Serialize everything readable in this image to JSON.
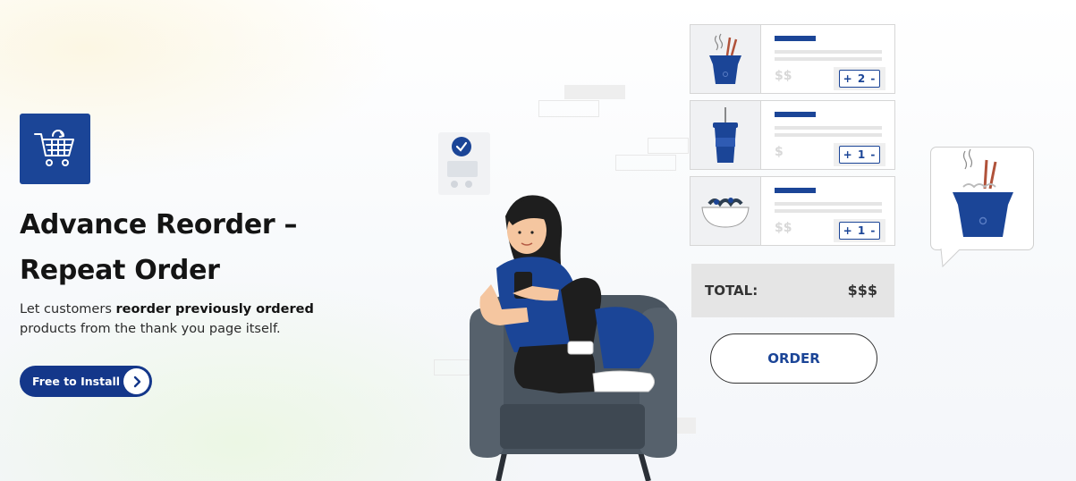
{
  "hero": {
    "title_line1": "Advance Reorder –",
    "title_line2": "Repeat Order",
    "subtitle_pre": "Let customers ",
    "subtitle_bold": "reorder previously ordered",
    "subtitle_post": " products from the thank you page itself.",
    "cta_label": "Free to Install"
  },
  "illustration": {
    "order_items": [
      {
        "icon": "noodle-box-icon",
        "price": "$$",
        "qty": "+ 2 -"
      },
      {
        "icon": "drink-cup-icon",
        "price": "$",
        "qty": "+ 1 -"
      },
      {
        "icon": "salad-bowl-icon",
        "price": "$$",
        "qty": "+ 1 -"
      }
    ],
    "total_label": "TOTAL:",
    "total_value": "$$$",
    "order_button": "ORDER"
  },
  "colors": {
    "brand_blue": "#1b4597",
    "cta_blue": "#14378a",
    "text_dark": "#141414"
  }
}
